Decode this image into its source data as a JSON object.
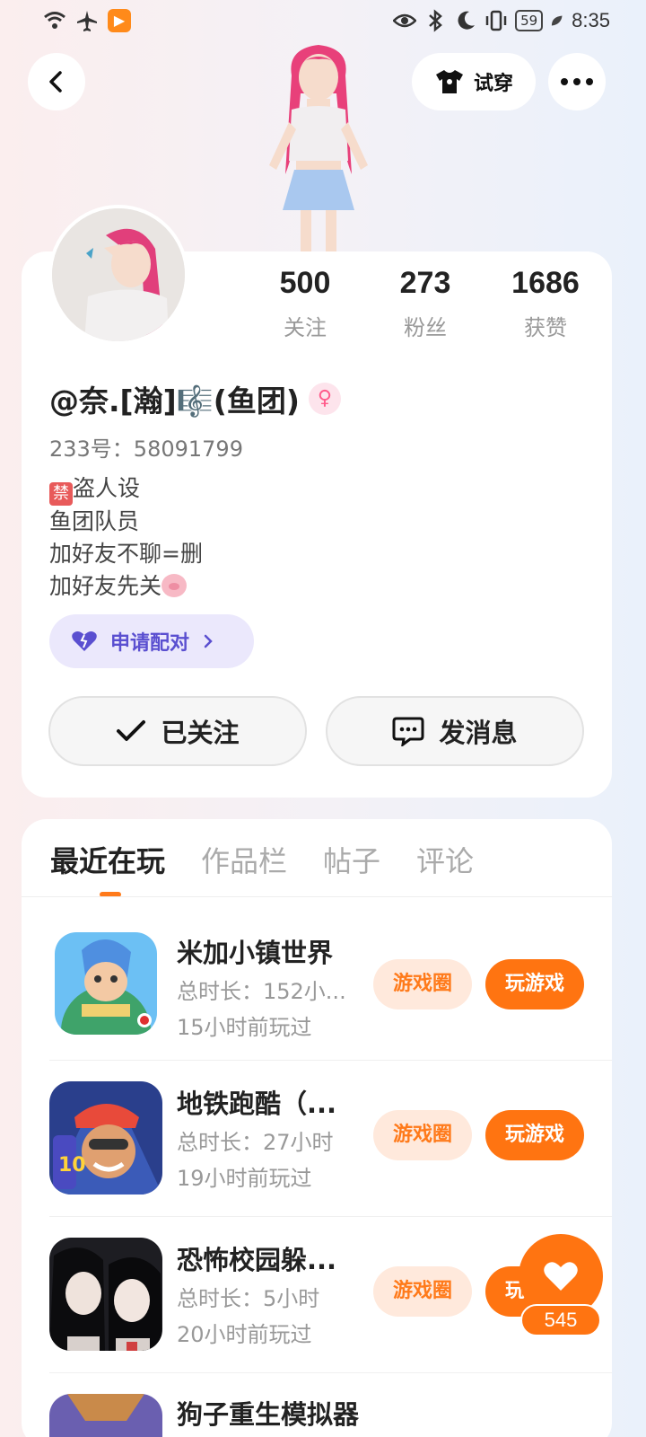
{
  "status_bar": {
    "time": "8:35",
    "battery": "59"
  },
  "header": {
    "tryon_label": "试穿"
  },
  "profile": {
    "stats": [
      {
        "value": "500",
        "label": "关注"
      },
      {
        "value": "273",
        "label": "粉丝"
      },
      {
        "value": "1686",
        "label": "获赞"
      }
    ],
    "username": "@奈.[瀚]🎼(鱼团)",
    "gender": "♀",
    "uid": "233号：58091799",
    "bio_lines": [
      "盗人设",
      "鱼团队员",
      "加好友不聊=删",
      "加好友先关"
    ],
    "ban_char": "禁",
    "pair_label": "申请配对",
    "follow_label": "已关注",
    "message_label": "发消息"
  },
  "tabs": [
    "最近在玩",
    "作品栏",
    "帖子",
    "评论"
  ],
  "games": [
    {
      "title": "米加小镇世界",
      "duration": "总时长：152小...",
      "last_played": "15小时前玩过",
      "circle_label": "游戏圈",
      "play_label": "玩游戏"
    },
    {
      "title": "地铁跑酷（...",
      "duration": "总时长：27小时",
      "last_played": "19小时前玩过",
      "circle_label": "游戏圈",
      "play_label": "玩游戏"
    },
    {
      "title": "恐怖校园躲...",
      "duration": "总时长：5小时",
      "last_played": "20小时前玩过",
      "circle_label": "游戏圈",
      "play_label": "玩游戏"
    },
    {
      "title": "狗子重生模拟器"
    }
  ],
  "floating_like": {
    "count": "545"
  },
  "colors": {
    "accent": "#ff7411",
    "pair_purple": "#5a4fd0"
  }
}
